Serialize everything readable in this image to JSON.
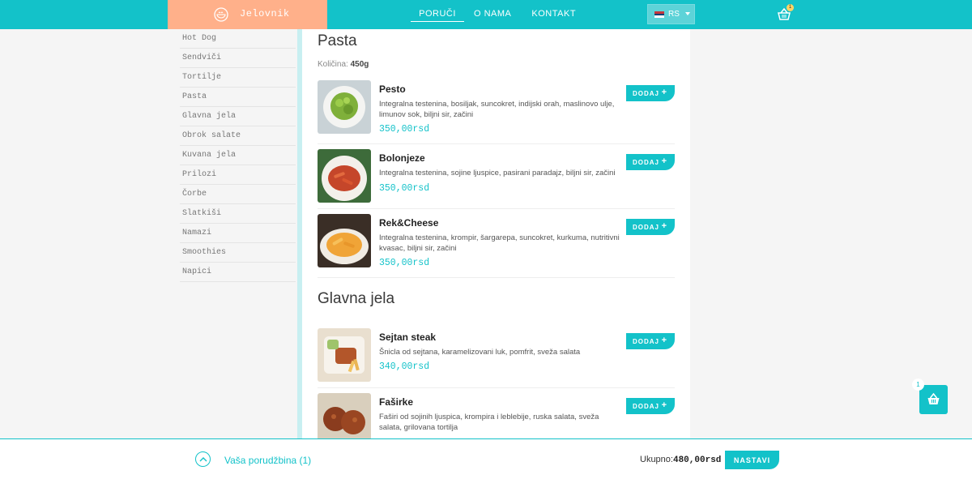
{
  "header": {
    "brand": "Jelovnik",
    "nav": [
      "PORUČI",
      "O NAMA",
      "KONTAKT"
    ],
    "language": "RS",
    "cart_count": "1"
  },
  "sidebar": {
    "categories": [
      "Hot Dog",
      "Sendviči",
      "Tortilje",
      "Pasta",
      "Glavna jela",
      "Obrok salate",
      "Kuvana jela",
      "Prilozi",
      "Čorbe",
      "Slatkiši",
      "Namazi",
      "Smoothies",
      "Napici"
    ]
  },
  "sections": [
    {
      "title": "Pasta",
      "quantity_label": "Količina:",
      "quantity_value": "450g",
      "items": [
        {
          "name": "Pesto",
          "description": "Integralna testenina, bosiljak, suncokret, indijski orah, maslinovo ulje, limunov sok, biljni sir, začini",
          "price": "350,00rsd",
          "button": "DODAJ"
        },
        {
          "name": "Bolonjeze",
          "description": "Integralna testenina, sojine ljuspice, pasirani paradajz, biljni sir, začini",
          "price": "350,00rsd",
          "button": "DODAJ"
        },
        {
          "name": "Rek&Cheese",
          "description": "Integralna testenina, krompir, šargarepa, suncokret, kurkuma, nutritivni kvasac, biljni sir, začini",
          "price": "350,00rsd",
          "button": "DODAJ"
        }
      ]
    },
    {
      "title": "Glavna jela",
      "items": [
        {
          "name": "Sejtan steak",
          "description": "Šnicla od sejtana, karamelizovani luk, pomfrit, sveža salata",
          "price": "340,00rsd",
          "button": "DODAJ"
        },
        {
          "name": "Faširke",
          "description": "Faširi od sojinih ljuspica, krompira i leblebije, ruska salata, sveža salata, grilovana tortilja",
          "price": "",
          "button": "DODAJ"
        }
      ]
    }
  ],
  "floating_cart": {
    "count": "1"
  },
  "footer": {
    "order_label": "Vaša porudžbina (1)",
    "total_label": "Ukupno:",
    "total_value": "480,00rsd",
    "next_button": "NASTAVI"
  },
  "colors": {
    "accent": "#13c2c9",
    "brand": "#ffb08a",
    "badge": "#ffd466"
  },
  "icons": [
    "food-bowl-icon",
    "serbia-flag-icon",
    "chevron-down-icon",
    "basket-icon",
    "plus-icon",
    "chevron-up-icon"
  ]
}
